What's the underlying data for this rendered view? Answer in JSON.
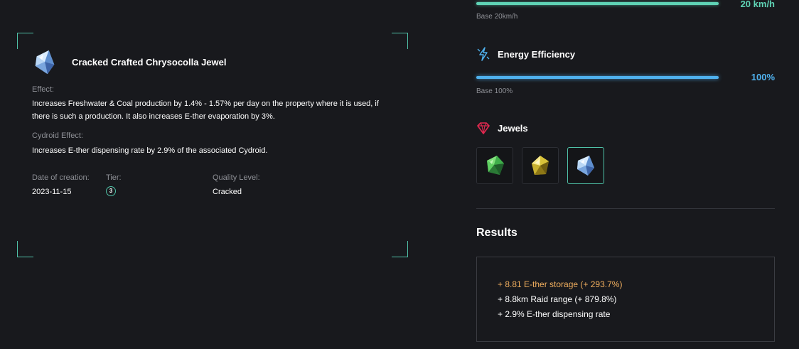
{
  "jewel": {
    "name": "Cracked Crafted Chrysocolla Jewel",
    "effect_label": "Effect:",
    "effect_line1": "Increases Freshwater & Coal production by 1.4% - 1.57% per day on the property where it is used, if",
    "effect_line2": "there is such a production. It also increases E-ther evaporation by 3%.",
    "cydroid_label": "Cydroid Effect:",
    "cydroid_text": "Increases E-ther dispensing rate by 2.9% of the associated Cydroid.",
    "date_label": "Date of creation:",
    "date_value": "2023-11-15",
    "tier_label": "Tier:",
    "tier_value": "3",
    "quality_label": "Quality Level:",
    "quality_value": "Cracked"
  },
  "speed": {
    "value": "20 km/h",
    "base": "Base 20km/h",
    "fill_fraction": 1.0,
    "color": "#5fd3b5"
  },
  "energy": {
    "title": "Energy Efficiency",
    "icon": "lightning-icon",
    "value": "100%",
    "base": "Base 100%",
    "fill_fraction": 1.0,
    "color": "#4fb1ee"
  },
  "jewels": {
    "title": "Jewels",
    "icon": "ruby-gem-icon",
    "slots": [
      {
        "name": "green-jewel-icon",
        "active": false
      },
      {
        "name": "yellow-jewel-icon",
        "active": false
      },
      {
        "name": "chrysocolla-jewel-icon",
        "active": true
      }
    ]
  },
  "results": {
    "title": "Results",
    "lines": [
      "+ 8.81 E-ther storage (+ 293.7%)",
      "+ 8.8km Raid range (+ 879.8%)",
      "+ 2.9% E-ther dispensing rate"
    ],
    "highlight_color": "#f0ae5e",
    "accent_color": "#4fc1a7"
  }
}
